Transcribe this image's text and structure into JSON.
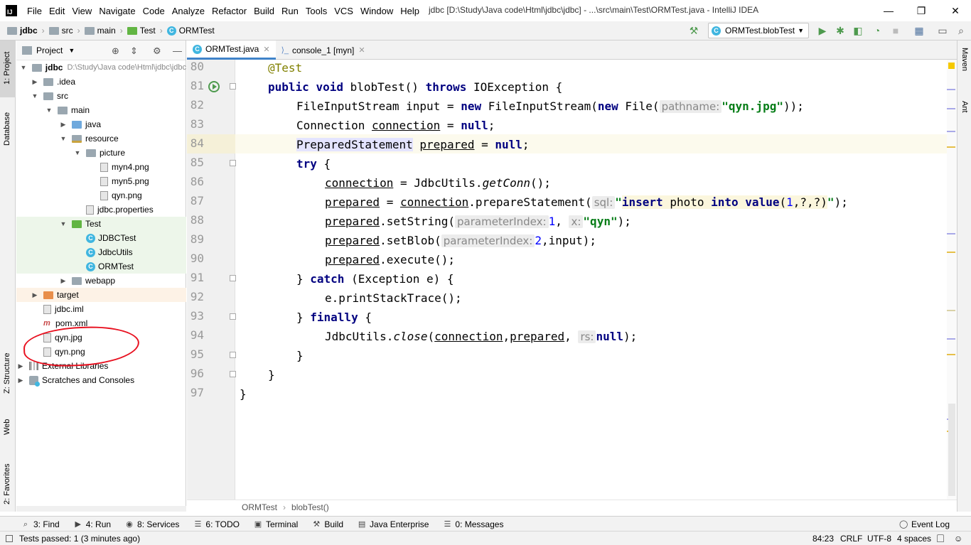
{
  "window": {
    "logo": "IJ",
    "title": "jdbc [D:\\Study\\Java code\\Html\\jdbc\\jdbc] - ...\\src\\main\\Test\\ORMTest.java - IntelliJ IDEA",
    "minimize": "—",
    "maximize": "❐",
    "close": "✕"
  },
  "menu": [
    "File",
    "Edit",
    "View",
    "Navigate",
    "Code",
    "Analyze",
    "Refactor",
    "Build",
    "Run",
    "Tools",
    "VCS",
    "Window",
    "Help"
  ],
  "breadcrumb": [
    "jdbc",
    "src",
    "main",
    "Test",
    "ORMTest"
  ],
  "run_config": {
    "label": "ORMTest.blobTest",
    "icon": "class-icon"
  },
  "toolbar_icons": [
    "hammer-icon",
    "run-icon",
    "debug-icon",
    "coverage-icon",
    "profile-icon",
    "stop-icon",
    "project-structure-icon",
    "layout-icon",
    "search-everywhere-icon"
  ],
  "left_tabs": [
    "1: Project",
    "Database",
    "Z: Structure",
    "Web",
    "2: Favorites"
  ],
  "right_tabs": [
    "Maven",
    "Ant"
  ],
  "project_panel": {
    "title": "Project",
    "tree": [
      {
        "label": "jdbc",
        "path": "D:\\Study\\Java code\\Html\\jdbc\\jdbc",
        "level": 0,
        "expanded": true,
        "icon": "folder",
        "bold": true
      },
      {
        "label": ".idea",
        "level": 1,
        "expanded": false,
        "icon": "folder"
      },
      {
        "label": "src",
        "level": 1,
        "expanded": true,
        "icon": "folder"
      },
      {
        "label": "main",
        "level": 2,
        "expanded": true,
        "icon": "folder"
      },
      {
        "label": "java",
        "level": 3,
        "expanded": false,
        "icon": "folder-blue"
      },
      {
        "label": "resource",
        "level": 3,
        "expanded": true,
        "icon": "folder-resource"
      },
      {
        "label": "picture",
        "level": 4,
        "expanded": true,
        "icon": "folder"
      },
      {
        "label": "myn4.png",
        "level": 5,
        "icon": "image-file"
      },
      {
        "label": "myn5.png",
        "level": 5,
        "icon": "image-file"
      },
      {
        "label": "qyn.png",
        "level": 5,
        "icon": "image-file"
      },
      {
        "label": "jdbc.properties",
        "level": 4,
        "icon": "properties-file"
      },
      {
        "label": "Test",
        "level": 3,
        "expanded": true,
        "icon": "folder-green",
        "highlight": true
      },
      {
        "label": "JDBCTest",
        "level": 4,
        "icon": "class",
        "highlight": true
      },
      {
        "label": "JdbcUtils",
        "level": 4,
        "icon": "class",
        "highlight": true
      },
      {
        "label": "ORMTest",
        "level": 4,
        "icon": "class",
        "highlight": true
      },
      {
        "label": "webapp",
        "level": 3,
        "expanded": false,
        "icon": "folder"
      },
      {
        "label": "target",
        "level": 1,
        "expanded": false,
        "icon": "folder-orange",
        "highlight": true
      },
      {
        "label": "jdbc.iml",
        "level": 1,
        "icon": "iml-file"
      },
      {
        "label": "pom.xml",
        "level": 1,
        "icon": "maven"
      },
      {
        "label": "qyn.jpg",
        "level": 1,
        "icon": "image-file"
      },
      {
        "label": "qyn.png",
        "level": 1,
        "icon": "image-file"
      },
      {
        "label": "External Libraries",
        "level": 0,
        "expanded": false,
        "icon": "library"
      },
      {
        "label": "Scratches and Consoles",
        "level": 0,
        "expanded": false,
        "icon": "scratch"
      }
    ]
  },
  "editor_tabs": [
    {
      "label": "ORMTest.java",
      "active": true,
      "icon": "class-icon"
    },
    {
      "label": "console_1 [myn]",
      "active": false,
      "icon": "console-icon"
    }
  ],
  "code": {
    "line_numbers": [
      "80",
      "81",
      "82",
      "83",
      "84",
      "85",
      "86",
      "87",
      "88",
      "89",
      "90",
      "91",
      "92",
      "93",
      "94",
      "95",
      "96",
      "97"
    ],
    "caret_line": "84",
    "tokens": {
      "l80": [
        "@Test"
      ],
      "l81": [
        "public",
        " ",
        "void",
        " blobTest() ",
        "throws",
        " IOException {"
      ],
      "l82": [
        "FileInputStream input = ",
        "new",
        " FileInputStream(",
        "new",
        " File(",
        "pathname:",
        "\"qyn.jpg\"",
        "));"
      ],
      "l83": [
        "Connection ",
        "connection",
        " = ",
        "null",
        ";"
      ],
      "l84": [
        "PreparedStatement",
        " ",
        "prepared",
        " = ",
        "null",
        ";"
      ],
      "l85": [
        "try",
        " {"
      ],
      "l86": [
        "connection",
        " = JdbcUtils.",
        "getConn",
        "();"
      ],
      "l87": [
        "prepared",
        " = ",
        "connection",
        ".prepareStatement(",
        "sql:",
        "\"",
        "insert",
        " photo ",
        "into",
        " ",
        "value",
        "(",
        "1",
        ",?,?)",
        "\"",
        ");"
      ],
      "l88": [
        "prepared",
        ".setString(",
        "parameterIndex:",
        "1",
        ", ",
        "x:",
        "\"qyn\"",
        ");"
      ],
      "l89": [
        "prepared",
        ".setBlob(",
        "parameterIndex:",
        "2",
        ",input);"
      ],
      "l90": [
        "prepared",
        ".execute();"
      ],
      "l91": [
        "} ",
        "catch",
        " (Exception e) {"
      ],
      "l92": [
        "e.printStackTrace();"
      ],
      "l93": [
        "} ",
        "finally",
        " {"
      ],
      "l94": [
        "JdbcUtils.",
        "close",
        "(",
        "connection",
        ",",
        "prepared",
        ", ",
        "rs:",
        "null",
        ");"
      ],
      "l95": [
        "}"
      ],
      "l96": [
        "}"
      ],
      "l97": [
        "}"
      ]
    }
  },
  "editor_breadcrumb": [
    "ORMTest",
    "blobTest()"
  ],
  "bottom_tools": [
    {
      "label": "3: Find",
      "icon": "search-icon"
    },
    {
      "label": "4: Run",
      "icon": "run-icon"
    },
    {
      "label": "8: Services",
      "icon": "services-icon"
    },
    {
      "label": "6: TODO",
      "icon": "todo-icon"
    },
    {
      "label": "Terminal",
      "icon": "terminal-icon"
    },
    {
      "label": "Build",
      "icon": "hammer-icon"
    },
    {
      "label": "Java Enterprise",
      "icon": "java-enterprise-icon"
    },
    {
      "label": "0: Messages",
      "icon": "messages-icon"
    }
  ],
  "event_log": "Event Log",
  "status": {
    "message": "Tests passed: 1 (3 minutes ago)",
    "position": "84:23",
    "line_separator": "CRLF",
    "encoding": "UTF-8",
    "indent": "4 spaces"
  }
}
